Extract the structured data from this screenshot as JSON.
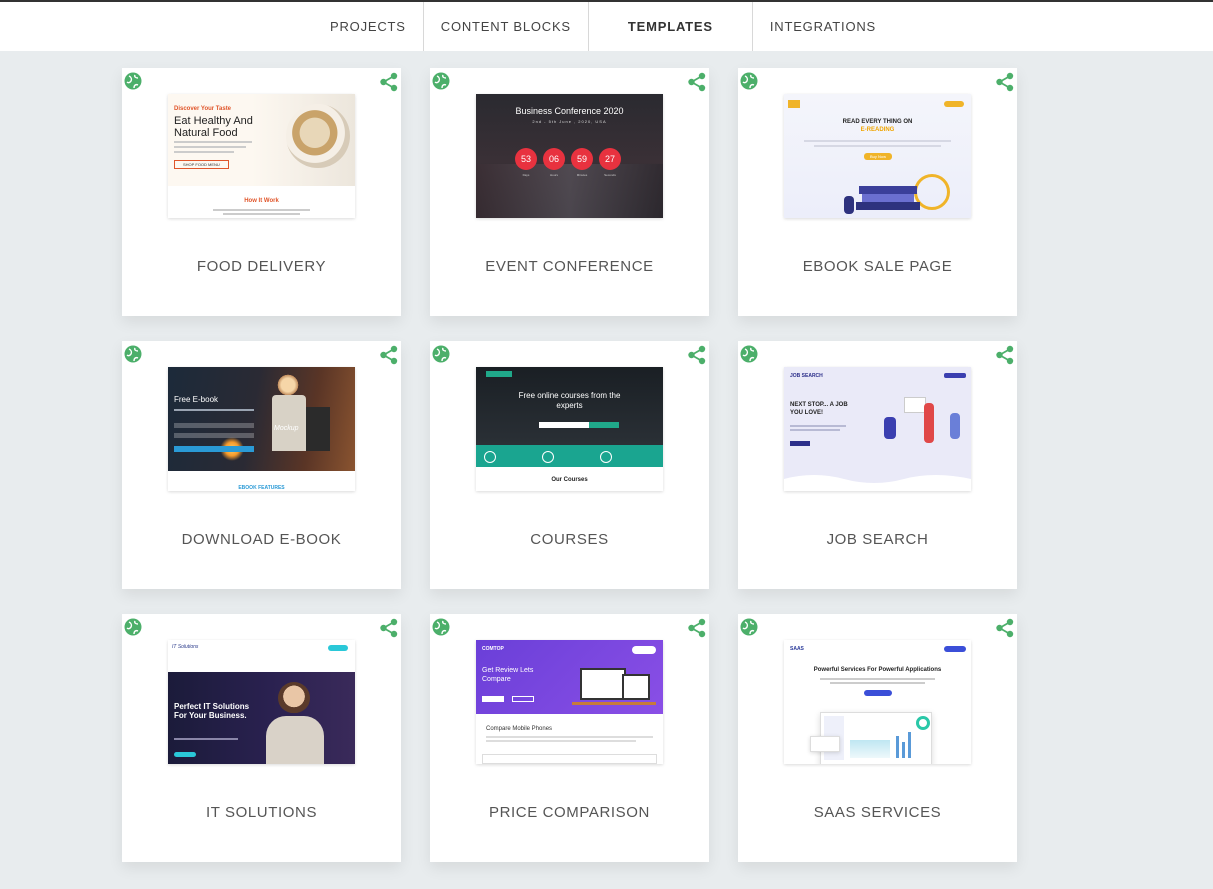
{
  "nav": {
    "tabs": [
      {
        "label": "PROJECTS"
      },
      {
        "label": "CONTENT BLOCKS"
      },
      {
        "label": "TEMPLATES"
      },
      {
        "label": "INTEGRATIONS"
      }
    ],
    "active": "TEMPLATES"
  },
  "colors": {
    "icon": "#4caf6a",
    "background": "#e8ecee"
  },
  "templates": [
    {
      "title": "FOOD DELIVERY",
      "preview": {
        "tag": "Discover Your Taste",
        "headline": "Eat Healthy And Natural Food",
        "button": "SHOP FOOD MENU",
        "section": "How It Work"
      }
    },
    {
      "title": "EVENT CONFERENCE",
      "preview": {
        "headline": "Business Conference 2020",
        "sub": "2nd - 5th June , 2020, USA",
        "countdown": [
          "53",
          "06",
          "59",
          "27"
        ],
        "units": [
          "Days",
          "Hours",
          "Minutes",
          "Seconds"
        ]
      }
    },
    {
      "title": "EBOOK SALE PAGE",
      "preview": {
        "headline": "READ EVERY THING ON",
        "accent": "E-READING",
        "button": "Buy Now"
      }
    },
    {
      "title": "DOWNLOAD E-BOOK",
      "preview": {
        "headline": "Free E-book",
        "book": "Mockup",
        "section": "EBOOK FEATURES"
      }
    },
    {
      "title": "COURSES",
      "preview": {
        "headline": "Free online courses from the experts",
        "section": "Our Courses"
      }
    },
    {
      "title": "JOB SEARCH",
      "preview": {
        "logo": "JOB SEARCH",
        "headline": "NEXT STOP... A JOB YOU LOVE!"
      }
    },
    {
      "title": "IT SOLUTIONS",
      "preview": {
        "logo": "IT Solutions",
        "headline": "Perfect IT Solutions For Your Business."
      }
    },
    {
      "title": "PRICE COMPARISON",
      "preview": {
        "logo": "COMTOP",
        "headline": "Get Review Lets Compare",
        "section": "Compare Mobile Phones"
      }
    },
    {
      "title": "SAAS SERVICES",
      "preview": {
        "logo": "SAAS",
        "headline": "Powerful Services For Powerful Applications"
      }
    }
  ]
}
